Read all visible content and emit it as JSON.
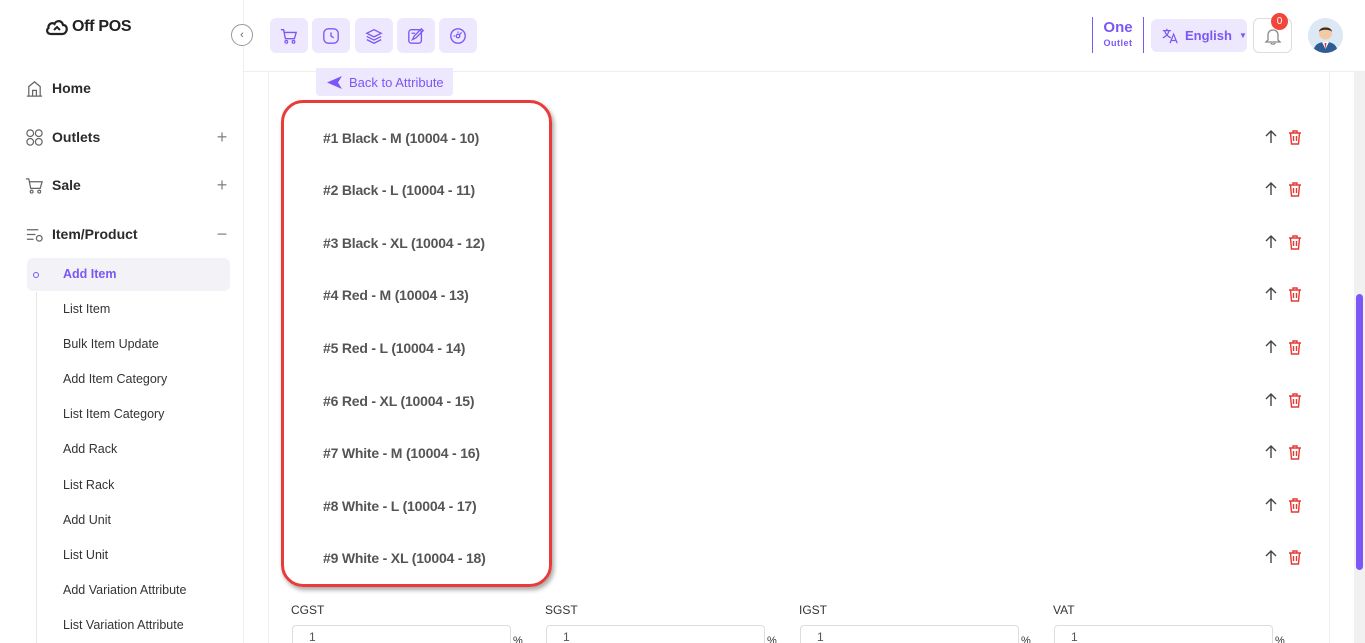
{
  "brand": {
    "name": "Off POS"
  },
  "sidebar": {
    "menu": [
      {
        "label": "Home",
        "icon": "home-icon",
        "toggle": ""
      },
      {
        "label": "Outlets",
        "icon": "outlets-icon",
        "toggle": "+"
      },
      {
        "label": "Sale",
        "icon": "cart-icon",
        "toggle": "+"
      },
      {
        "label": "Item/Product",
        "icon": "product-icon",
        "toggle": "−"
      }
    ],
    "submenu": [
      {
        "label": "Add Item",
        "active": true
      },
      {
        "label": "List Item"
      },
      {
        "label": "Bulk Item Update"
      },
      {
        "label": "Add Item Category"
      },
      {
        "label": "List Item Category"
      },
      {
        "label": "Add Rack"
      },
      {
        "label": "List Rack"
      },
      {
        "label": "Add Unit"
      },
      {
        "label": "List Unit"
      },
      {
        "label": "Add Variation Attribute"
      },
      {
        "label": "List Variation Attribute"
      }
    ]
  },
  "header": {
    "quick_buttons": [
      "cart-icon",
      "clock-icon",
      "layers-icon",
      "edit-icon",
      "dashboard-icon"
    ],
    "outlet": {
      "name": "One",
      "label": "Outlet"
    },
    "language": "English",
    "notification_count": "0"
  },
  "main": {
    "back_button": "Back to Attribute",
    "variations": [
      "#1 Black - M (10004 - 10)",
      "#2 Black - L (10004 - 11)",
      "#3 Black - XL (10004 - 12)",
      "#4 Red - M (10004 - 13)",
      "#5 Red - L (10004 - 14)",
      "#6 Red - XL (10004 - 15)",
      "#7 White - M (10004 - 16)",
      "#8 White - L (10004 - 17)",
      "#9 White - XL (10004 - 18)"
    ],
    "taxes": [
      {
        "label": "CGST",
        "value": "1",
        "unit": "%"
      },
      {
        "label": "SGST",
        "value": "1",
        "unit": "%"
      },
      {
        "label": "IGST",
        "value": "1",
        "unit": "%"
      },
      {
        "label": "VAT",
        "value": "1",
        "unit": "%"
      }
    ]
  },
  "colors": {
    "accent": "#7b57f5",
    "accent_light": "#ede8fd",
    "danger": "#ea3b3b",
    "delete": "#e53935"
  }
}
